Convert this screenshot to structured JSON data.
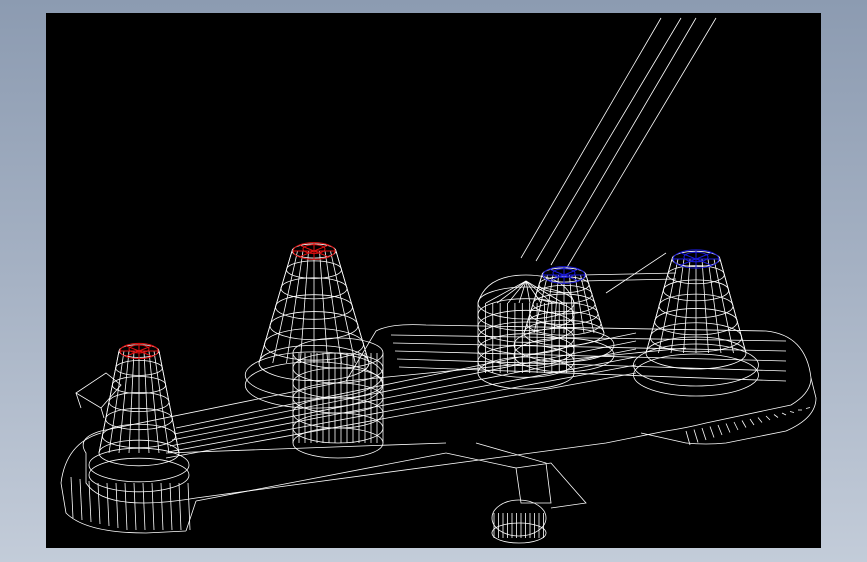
{
  "viewport": {
    "background": "#000000",
    "view_style": "wireframe",
    "colors": {
      "wire": "#ffffff",
      "hot_cap": "#e01010",
      "cold_cap": "#1a1ad8"
    }
  },
  "model": {
    "description_icon": "faucet-wireframe-icon",
    "parts": [
      {
        "id": "base-plate",
        "icon": "base-plate-icon"
      },
      {
        "id": "spout-pipe",
        "icon": "pipe-icon"
      },
      {
        "id": "hot-valve-left",
        "icon": "valve-icon",
        "cap_color": "hot_cap"
      },
      {
        "id": "hot-valve-center",
        "icon": "valve-icon",
        "cap_color": "hot_cap"
      },
      {
        "id": "cold-valve-center",
        "icon": "valve-icon",
        "cap_color": "cold_cap"
      },
      {
        "id": "cold-valve-right",
        "icon": "valve-icon",
        "cap_color": "cold_cap"
      },
      {
        "id": "mixer-body",
        "icon": "cylinder-icon"
      },
      {
        "id": "drain-stub",
        "icon": "cylinder-icon"
      }
    ]
  }
}
